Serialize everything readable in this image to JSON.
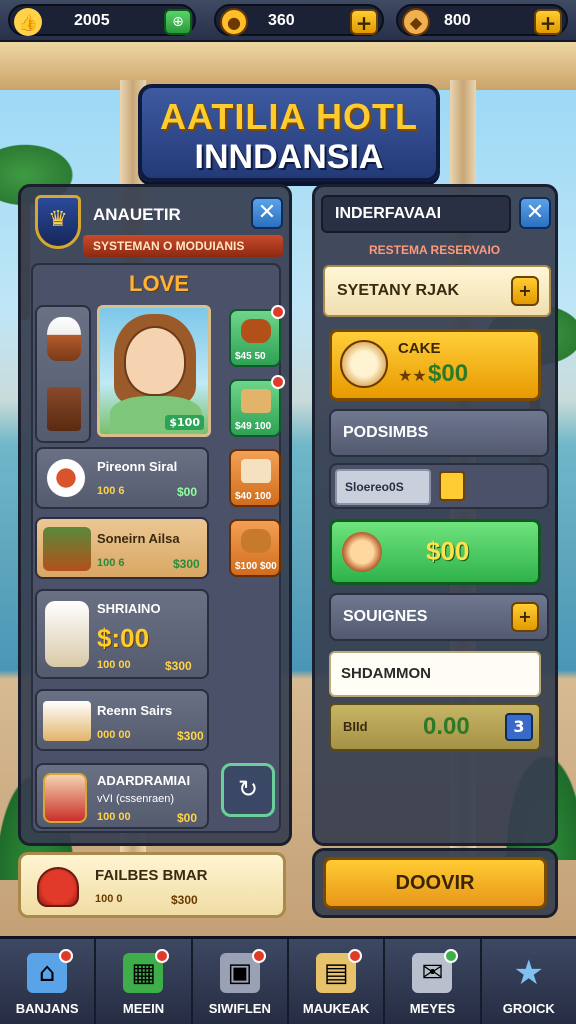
{
  "topbar": {
    "resources": [
      {
        "icon": "thumbs-up-icon",
        "value": "2005"
      },
      {
        "icon": "coin-icon",
        "value": "360"
      },
      {
        "icon": "gem-icon",
        "value": "800"
      }
    ],
    "plus_label": "+"
  },
  "title": {
    "line1": "AATILIA HOTL",
    "line2": "INNDANSIA"
  },
  "left_panel": {
    "title": "ANAUETIR",
    "subtitle": "SYSTEMAN O MODUIANIS",
    "section": "LOVE",
    "portrait_price": "$100",
    "rows": [
      {
        "name": "Pireonn Siral",
        "meta": "100 6",
        "price": "$00"
      },
      {
        "name": "Soneirn Ailsa",
        "meta": "100 6",
        "price": "$300"
      },
      {
        "name": "SHRIAINO",
        "big": "$:00",
        "meta": "100 00",
        "price": "$300"
      },
      {
        "name": "Reenn Sairs",
        "meta": "000 00",
        "price": "$300"
      },
      {
        "name": "ADARDRAMIAI",
        "sub": "vVI (cssenraen)",
        "meta": "100 00",
        "price": "$00"
      }
    ],
    "icon_tiles": [
      {
        "label": "$45 50"
      },
      {
        "label": "$49 100"
      },
      {
        "label": "$40 100"
      },
      {
        "label": "$100 $00"
      }
    ]
  },
  "right_panel": {
    "title": "INDERFAVAAI",
    "subtitle": "RESTEMA RESERVAIO",
    "item1": "SYETANY RJAK",
    "cake": {
      "label": "CAKE",
      "price": "$00"
    },
    "section2": "PODSIMBS",
    "search": "Sloereo0S",
    "green_price": "$00",
    "section3": "SOUIGNES",
    "input_value": "SHDAMMON",
    "bid": {
      "label": "BIId",
      "value": "0.00",
      "count": "3"
    }
  },
  "book_button": "DOOVIR",
  "feedback": {
    "title": "FAILBES BMAR",
    "meta": "100 0",
    "price": "$300"
  },
  "nav": [
    {
      "label": "BANJANS",
      "icon": "home-icon",
      "badge": true
    },
    {
      "label": "MEEIN",
      "icon": "map-icon",
      "badge": true
    },
    {
      "label": "SIWIFLEN",
      "icon": "staff-icon",
      "badge": true
    },
    {
      "label": "MAUKEAK",
      "icon": "market-icon",
      "badge": true
    },
    {
      "label": "MEYES",
      "icon": "mail-icon",
      "badge": true
    },
    {
      "label": "GROICK",
      "icon": "star-icon",
      "badge": false
    }
  ],
  "colors": {
    "accent": "#ffcc2e",
    "panel": "#373e50",
    "nav": "#262d43"
  }
}
